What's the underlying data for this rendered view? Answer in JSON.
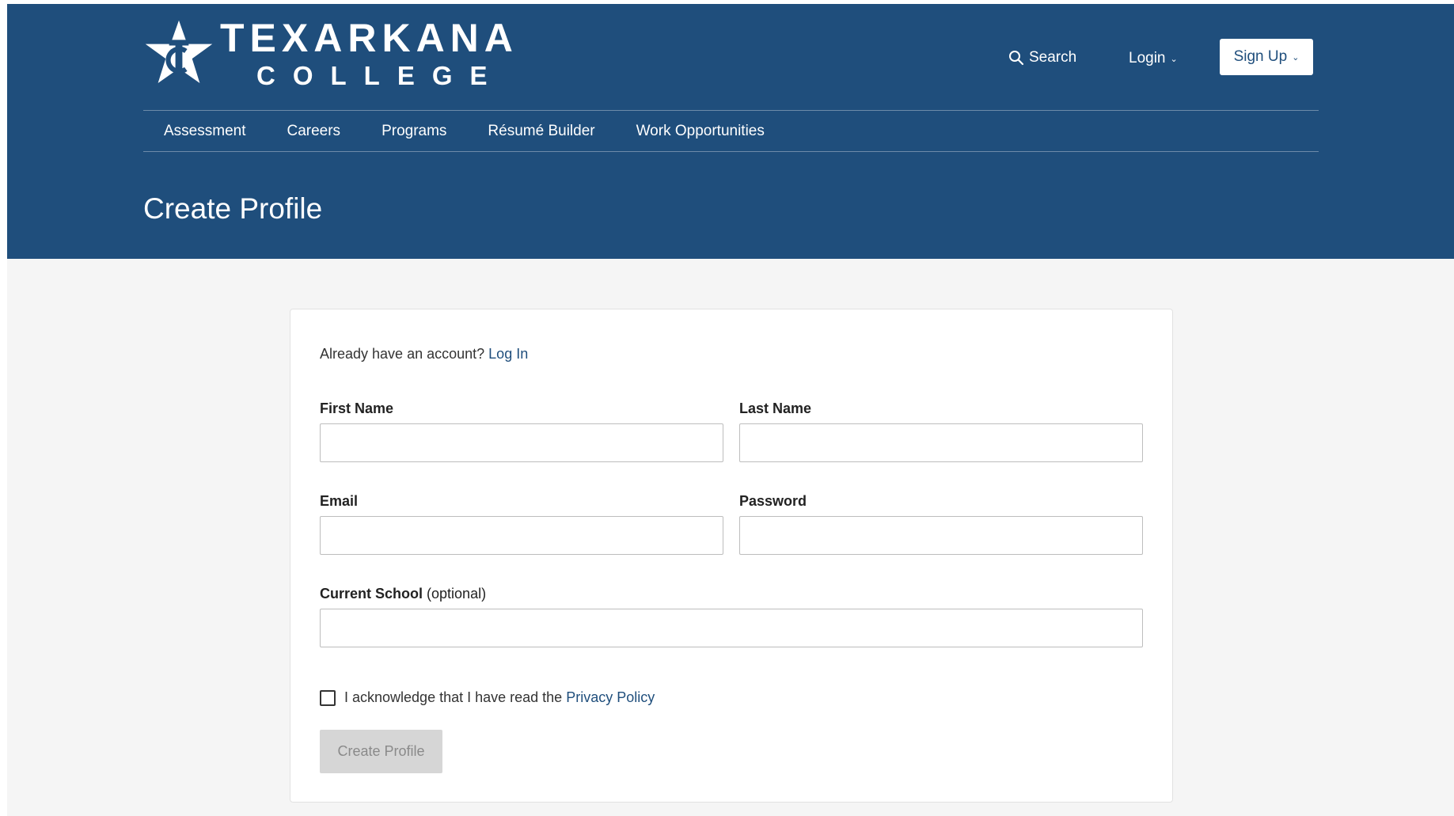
{
  "brand": {
    "name_line1": "TEXARKANA",
    "name_line2": "COLLEGE",
    "primary_color": "#1f4e7c"
  },
  "header": {
    "search_label": "Search",
    "login_label": "Login",
    "signup_label": "Sign Up"
  },
  "nav": {
    "items": [
      {
        "label": "Assessment"
      },
      {
        "label": "Careers"
      },
      {
        "label": "Programs"
      },
      {
        "label": "Résumé Builder"
      },
      {
        "label": "Work Opportunities"
      }
    ]
  },
  "page": {
    "title": "Create Profile"
  },
  "form": {
    "already_text": "Already have an account?",
    "login_link": "Log In",
    "first_name_label": "First Name",
    "first_name_value": "",
    "last_name_label": "Last Name",
    "last_name_value": "",
    "email_label": "Email",
    "email_value": "",
    "password_label": "Password",
    "password_value": "",
    "school_label": "Current School",
    "school_optional": "(optional)",
    "school_value": "",
    "ack_text": "I acknowledge that I have read the",
    "privacy_link": "Privacy Policy",
    "ack_checked": false,
    "submit_label": "Create Profile"
  },
  "icons": {
    "search": "search-icon",
    "caret": "chevron-down-icon",
    "logo": "tc-star-logo"
  }
}
